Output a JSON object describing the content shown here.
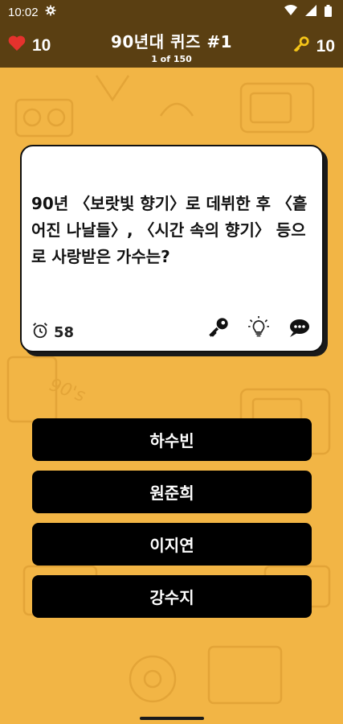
{
  "status_bar": {
    "time": "10:02"
  },
  "header": {
    "lives": "10",
    "title": "90년대 퀴즈 #1",
    "progress": "1 of 150",
    "keys": "10"
  },
  "question": {
    "text": "90년 〈보랏빛 향기〉로 데뷔한 후 〈흩어진 나날들〉, 〈시간 속의 향기〉 등으로 사랑받은 가수는?",
    "timer": "58"
  },
  "answers": [
    {
      "label": "하수빈"
    },
    {
      "label": "원준희"
    },
    {
      "label": "이지연"
    },
    {
      "label": "강수지"
    }
  ],
  "colors": {
    "background": "#f2b545",
    "header": "#5a3f12",
    "answer_button": "#000000",
    "heart": "#e5322d",
    "key": "#f5c518"
  }
}
